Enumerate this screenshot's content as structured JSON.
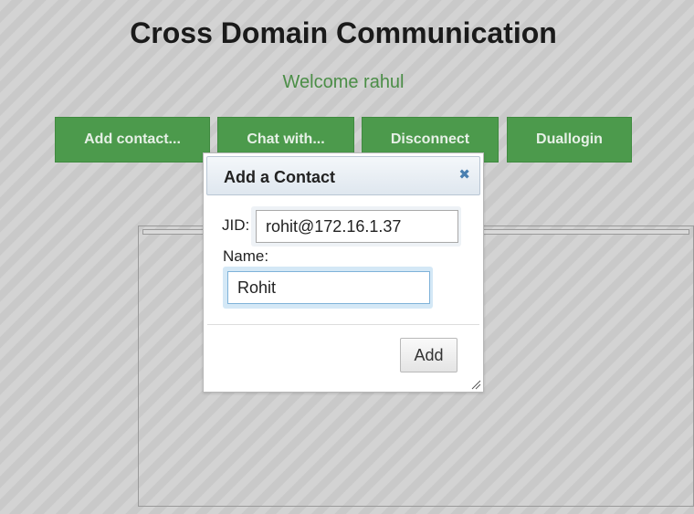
{
  "header": {
    "title": "Cross Domain Communication",
    "welcome": "Welcome rahul"
  },
  "toolbar": {
    "add_contact_label": "Add contact...",
    "chat_with_label": "Chat with...",
    "disconnect_label": "Disconnect",
    "duallogin_label": "Duallogin"
  },
  "dialog": {
    "title": "Add a Contact",
    "jid_label": "JID:",
    "jid_value": "rohit@172.16.1.37",
    "name_label": "Name:",
    "name_value": "Rohit",
    "add_label": "Add",
    "close_icon": "close-icon",
    "title_color": "#222222",
    "close_color": "#4a7fb0"
  },
  "colors": {
    "accent_green": "#4c9a4c",
    "welcome_green": "#4b8e47"
  }
}
